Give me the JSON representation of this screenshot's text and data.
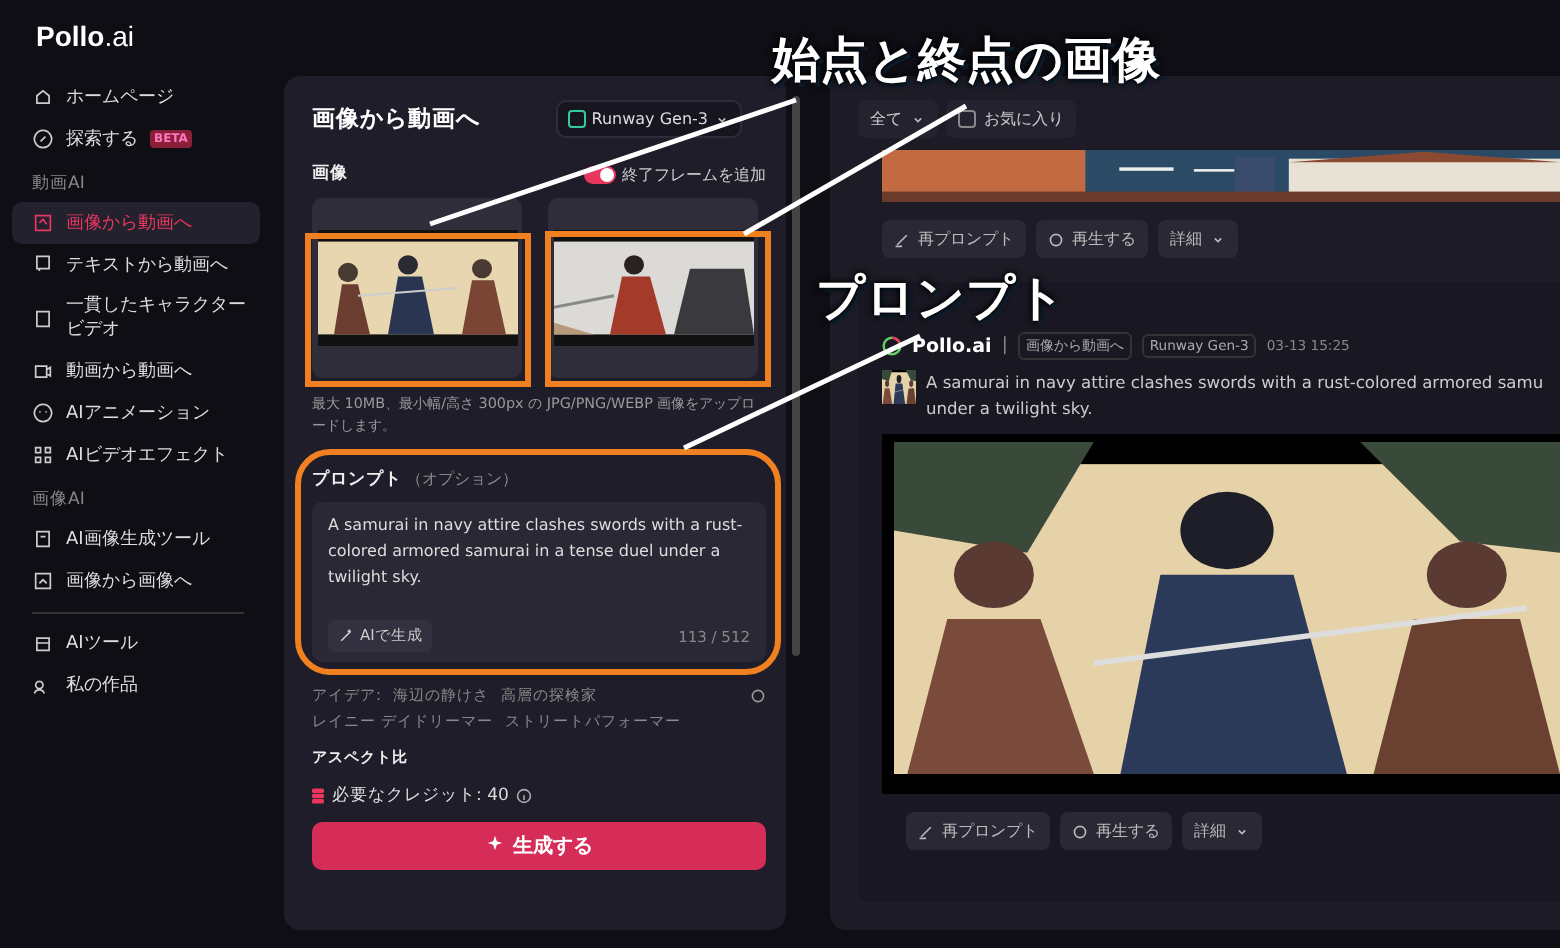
{
  "logo": {
    "name": "Pollo",
    "suffix": ".ai"
  },
  "sidebar": {
    "sections": [
      {
        "items": [
          {
            "label": "ホームページ",
            "selected": false
          },
          {
            "label": "探索する",
            "badge": "BETA",
            "selected": false
          }
        ]
      },
      {
        "heading": "動画AI",
        "items": [
          {
            "label": "画像から動画へ",
            "selected": true
          },
          {
            "label": "テキストから動画へ",
            "selected": false
          },
          {
            "label": "一貫したキャラクタービデオ",
            "selected": false
          },
          {
            "label": "動画から動画へ",
            "selected": false
          },
          {
            "label": "AIアニメーション",
            "selected": false
          },
          {
            "label": "AIビデオエフェクト",
            "selected": false
          }
        ]
      },
      {
        "heading": "画像AI",
        "items": [
          {
            "label": "AI画像生成ツール",
            "selected": false
          },
          {
            "label": "画像から画像へ",
            "selected": false
          }
        ]
      },
      {
        "divider": true,
        "items": [
          {
            "label": "AIツール",
            "selected": false
          },
          {
            "label": "私の作品",
            "selected": false
          }
        ]
      }
    ]
  },
  "form": {
    "title": "画像から動画へ",
    "model": "Runway Gen-3",
    "image_label": "画像",
    "end_frame": {
      "label": "終了フレームを追加",
      "on": true
    },
    "hint": "最大 10MB、最小幅/高さ 300px の JPG/PNG/WEBP 画像をアップロードします。",
    "prompt_label": "プロンプト",
    "prompt_optional": "（オプション）",
    "prompt": "A samurai in navy attire clashes swords with a rust-colored armored samurai in a tense duel under a twilight sky.",
    "ai_button": "AIで生成",
    "counter": "113 / 512",
    "ideas_label": "アイデア:",
    "ideas": [
      "海辺の静けさ",
      "高層の探検家",
      "レイニー デイドリーマー",
      "ストリートパフォーマー"
    ],
    "aspect_label": "アスペクト比",
    "credits": "必要なクレジット: 40",
    "generate": "生成する"
  },
  "results": {
    "filter": "全て",
    "favorite": {
      "label": "お気に入り",
      "checked": false
    },
    "actions": [
      "再プロンプト",
      "再生する",
      "詳細"
    ],
    "card": {
      "brand": "Pollo.ai",
      "separator": "|",
      "tags": [
        "画像から動画へ",
        "Runway Gen-3"
      ],
      "time": "03-13 15:25",
      "prompt_lines": [
        "A samurai in navy attire clashes swords with a rust-colored armored samu",
        "under a twilight sky."
      ],
      "actions": [
        "再プロンプト",
        "再生する",
        "詳細"
      ]
    }
  },
  "annotations": [
    "始点と終点の画像",
    "プロンプト"
  ]
}
